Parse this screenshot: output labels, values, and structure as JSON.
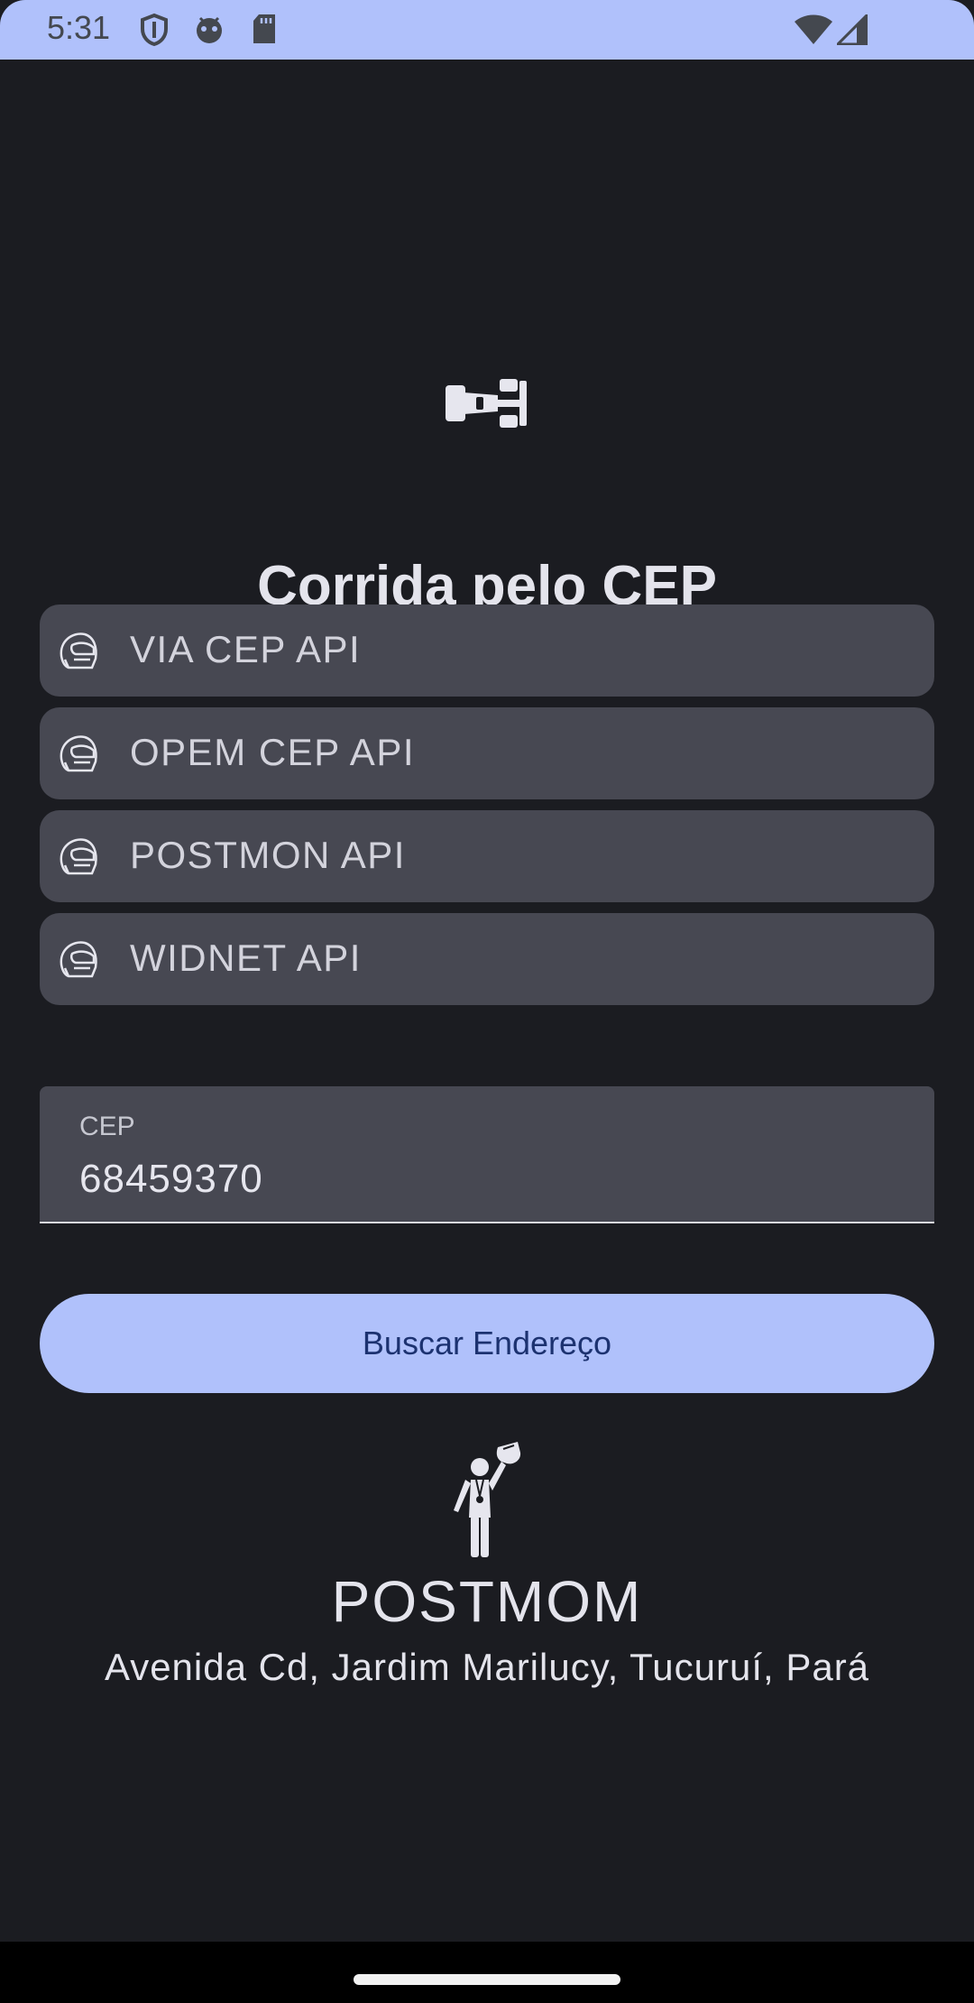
{
  "status_bar": {
    "time": "5:31",
    "icons": [
      "shield-icon",
      "robot-icon",
      "sd-card-icon",
      "wifi-icon",
      "signal-icon"
    ]
  },
  "app": {
    "header_icon": "race-car-icon",
    "title": "Corrida pelo CEP",
    "api_list": [
      {
        "icon": "helmet-icon",
        "label": "VIA CEP API"
      },
      {
        "icon": "helmet-icon",
        "label": "OPEM CEP API"
      },
      {
        "icon": "helmet-icon",
        "label": "POSTMON API"
      },
      {
        "icon": "helmet-icon",
        "label": "WIDNET API"
      }
    ],
    "cep_field": {
      "label": "CEP",
      "value": "68459370"
    },
    "search_button_label": "Buscar Endereço",
    "result": {
      "icon": "trophy-winner-icon",
      "winner": "POSTMOM",
      "address": "Avenida Cd, Jardim Marilucy, Tucuruí, Pará"
    }
  },
  "colors": {
    "background": "#1b1c21",
    "accent": "#b0c1fb",
    "field_background": "#474852",
    "button_text": "#1c3270"
  }
}
